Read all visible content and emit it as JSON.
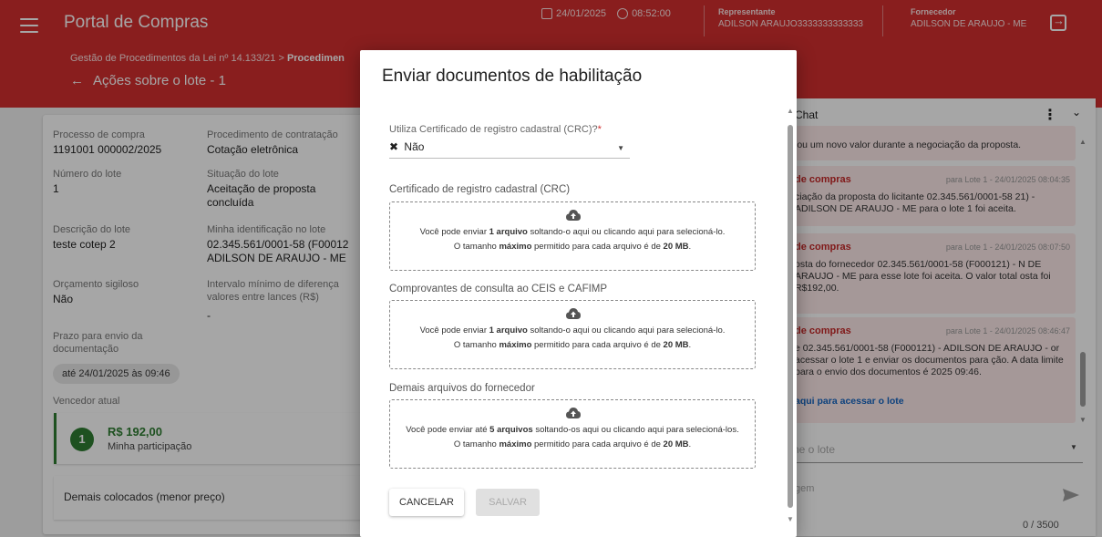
{
  "header": {
    "app_title": "Portal de Compras",
    "date": "24/01/2025",
    "time": "08:52:00",
    "representative_label": "Representante",
    "representative_name": "ADILSON ARAUJO3333333333333",
    "supplier_label": "Fornecedor",
    "supplier_name": "ADILSON DE ARAUJO - ME",
    "breadcrumb_prefix": "Gestão de Procedimentos da Lei nº 14.133/21 > ",
    "breadcrumb_current": "Procedimen",
    "page_title": "Ações sobre o lote - 1"
  },
  "lot": {
    "process_label": "Processo de compra",
    "process_value": "1191001 000002/2025",
    "procedure_label": "Procedimento de contratação",
    "procedure_value": "Cotação eletrônica",
    "lot_number_label": "Número do lote",
    "lot_number_value": "1",
    "status_label": "Situação do lote",
    "status_value": "Aceitação de proposta concluída",
    "description_label": "Descrição do lote",
    "description_value": "teste cotep 2",
    "my_id_label": "Minha identificação no lote",
    "my_id_value": "02.345.561/0001-58 (F00012 ADILSON DE ARAUJO - ME",
    "budget_label": "Orçamento sigiloso",
    "budget_value": "Não",
    "interval_label": "Intervalo mínimo de diferença valores entre lances (R$)",
    "interval_value": "-",
    "deadline_label": "Prazo para envio da documentação",
    "deadline_value": "até 24/01/2025 às 09:46",
    "winner_label": "Vencedor atual",
    "winner_position": "1",
    "winner_price": "R$ 192,00",
    "winner_sub": "Minha participação",
    "others_label": "Demais colocados (menor preço)"
  },
  "chat": {
    "title": "Chat",
    "messages": [
      {
        "sender": "",
        "meta": "",
        "body": "iou um novo valor durante a negociação da proposta.",
        "link": ""
      },
      {
        "sender": "de compras",
        "meta": "para Lote 1 - 24/01/2025 08:04:35",
        "body": "ciação da proposta do licitante 02.345.561/0001-58 21) - ADILSON DE ARAUJO - ME para o lote 1 foi aceita.",
        "link": ""
      },
      {
        "sender": "de compras",
        "meta": "para Lote 1 - 24/01/2025 08:07:50",
        "body": "osta do fornecedor 02.345.561/0001-58 (F000121) - N DE ARAUJO - ME para esse lote foi aceita. O valor total osta foi R$192,00.",
        "link": ""
      },
      {
        "sender": "de compras",
        "meta": "para Lote 1 - 24/01/2025 08:46:47",
        "body": "e 02.345.561/0001-58 (F000121) - ADILSON DE ARAUJO - or acessar o lote 1 e enviar os documentos para ção. A data limite para o envio dos documentos é 2025 09:46.",
        "link": "aqui para acessar o lote"
      }
    ],
    "select_placeholder": "ne o lote",
    "message_placeholder": "gem",
    "counter": "0 / 3500"
  },
  "modal": {
    "title": "Enviar documentos de habilitação",
    "crc_question": "Utiliza Certificado de registro cadastral (CRC)?",
    "crc_required_mark": "*",
    "crc_value": "Não",
    "sections": [
      {
        "title": "Certificado de registro cadastral (CRC)",
        "line1_a": "Você pode enviar ",
        "line1_b": "1 arquivo",
        "line1_c": " soltando-o aqui ou clicando aqui para selecioná-lo.",
        "line2_a": "O tamanho ",
        "line2_b": "máximo",
        "line2_c": " permitido para cada arquivo é de ",
        "line2_d": "20 MB",
        "line2_e": "."
      },
      {
        "title": "Comprovantes de consulta ao CEIS e CAFIMP",
        "line1_a": "Você pode enviar ",
        "line1_b": "1 arquivo",
        "line1_c": " soltando-o aqui ou clicando aqui para selecioná-lo.",
        "line2_a": "O tamanho ",
        "line2_b": "máximo",
        "line2_c": " permitido para cada arquivo é de ",
        "line2_d": "20 MB",
        "line2_e": "."
      },
      {
        "title": "Demais arquivos do fornecedor",
        "line1_a": "Você pode enviar até ",
        "line1_b": "5 arquivos",
        "line1_c": " soltando-os aqui ou clicando aqui para selecioná-los.",
        "line2_a": "O tamanho ",
        "line2_b": "máximo",
        "line2_c": " permitido para cada arquivo é de ",
        "line2_d": "20 MB",
        "line2_e": "."
      }
    ],
    "cancel_label": "CANCELAR",
    "save_label": "SALVAR"
  },
  "colors": {
    "brand_red": "#d32f2f",
    "winner_green": "#2e7d32",
    "chat_bg": "#fdeaea",
    "link_blue": "#1565c0"
  },
  "icons": [
    "menu-icon",
    "calendar-icon",
    "clock-icon",
    "logout-icon",
    "arrow-back-icon",
    "more-vert-icon",
    "chevron-down-icon",
    "cloud-upload-icon",
    "close-x-icon",
    "send-icon"
  ]
}
